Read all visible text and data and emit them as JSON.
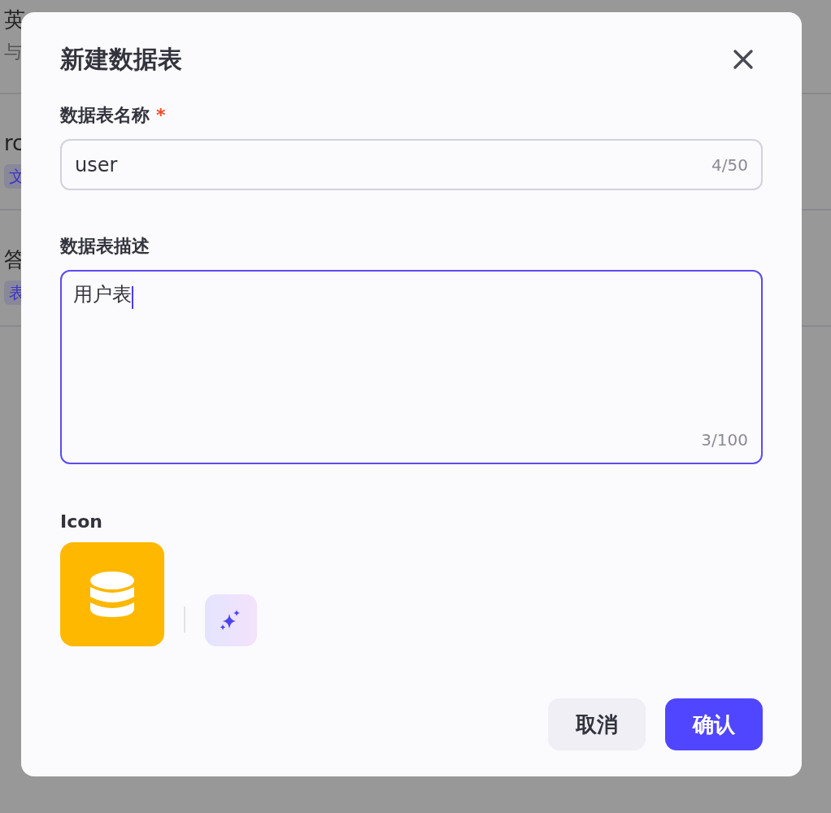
{
  "background_list": {
    "items": [
      {
        "title": "英",
        "subtitle": "与"
      },
      {
        "title": "rc",
        "tag": "文"
      },
      {
        "title": "答",
        "tag": "表"
      }
    ]
  },
  "dialog": {
    "title": "新建数据表",
    "fields": [
      {
        "kind": "input",
        "label": "数据表名称",
        "required_mark": "*",
        "value": "user",
        "counter": "4/50",
        "focused": false
      },
      {
        "kind": "textarea",
        "label": "数据表描述",
        "value": "用户表",
        "counter": "3/100",
        "focused": true
      }
    ],
    "icon_section": {
      "label": "Icon"
    },
    "buttons": [
      {
        "label": "取消",
        "kind": "secondary"
      },
      {
        "label": "确认",
        "kind": "primary"
      }
    ]
  }
}
